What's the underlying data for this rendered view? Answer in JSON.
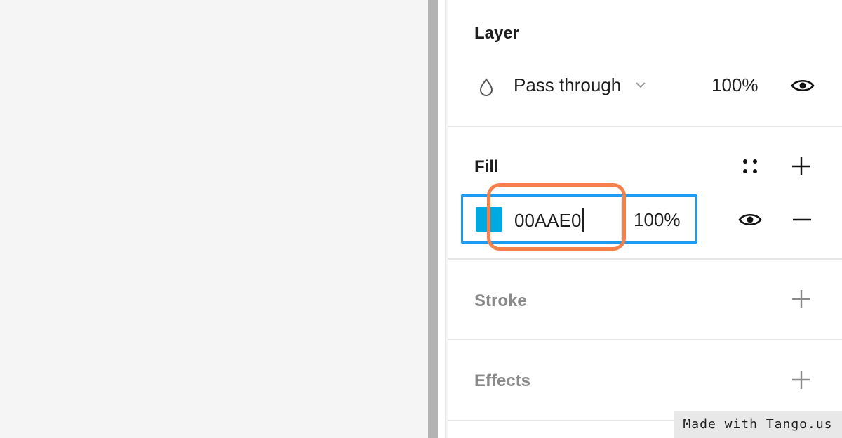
{
  "layer": {
    "title": "Layer",
    "blend_mode": "Pass through",
    "opacity": "100%"
  },
  "fill": {
    "title": "Fill",
    "hex_value": "00AAE0",
    "color": "#00AAE0",
    "opacity": "100%"
  },
  "stroke": {
    "title": "Stroke"
  },
  "effects": {
    "title": "Effects"
  },
  "watermark": "Made with Tango.us",
  "colors": {
    "selection_border": "#1d9bf0",
    "highlight": "#f5804b"
  }
}
